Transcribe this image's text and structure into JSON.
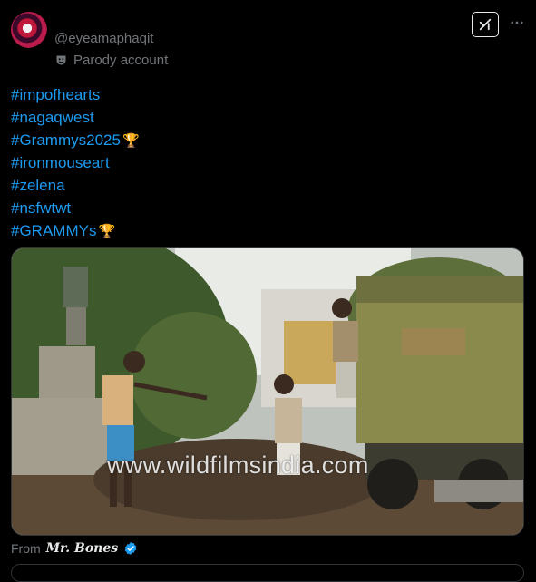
{
  "post": {
    "handle": "@eyeamaphaqit",
    "account_label": "Parody account",
    "hashtags": [
      {
        "text": "#impofhearts",
        "emoji": ""
      },
      {
        "text": "#nagaqwest",
        "emoji": ""
      },
      {
        "text": "#Grammys2025",
        "emoji": "🏆"
      },
      {
        "text": "#ironmouseart",
        "emoji": ""
      },
      {
        "text": "#zelena",
        "emoji": ""
      },
      {
        "text": "#nsfwtwt",
        "emoji": ""
      },
      {
        "text": "#GRAMMYs",
        "emoji": "🏆"
      }
    ],
    "media_watermark": "www.wildfilmsindia.com",
    "from_label": "From",
    "source_name": "Mr. Bones"
  },
  "icons": {
    "grok": "grok-icon",
    "more": "more-icon",
    "parody": "theater-mask-icon",
    "verified": "verified-badge-icon"
  },
  "colors": {
    "background": "#000000",
    "link": "#1d9bf0",
    "secondary_text": "#71767b",
    "primary_text": "#e7e9ea",
    "verified": "#1d9bf0"
  }
}
